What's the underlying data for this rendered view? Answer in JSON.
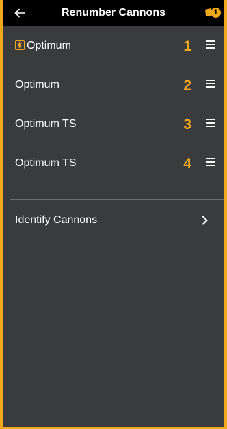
{
  "header": {
    "title": "Renumber Cannons",
    "notification_count": "1"
  },
  "cannons": [
    {
      "name": "Optimum",
      "number": "1",
      "bluetooth": true
    },
    {
      "name": "Optimum",
      "number": "2",
      "bluetooth": false
    },
    {
      "name": "Optimum TS",
      "number": "3",
      "bluetooth": false
    },
    {
      "name": "Optimum TS",
      "number": "4",
      "bluetooth": false
    }
  ],
  "identify": {
    "label": "Identify Cannons"
  },
  "colors": {
    "accent": "#f2a81d",
    "background": "#3a3b3d",
    "header": "#000000"
  },
  "icons": {
    "back": "arrow-left-icon",
    "notification": "cannon-notification-icon",
    "bluetooth": "bluetooth-icon",
    "drag": "drag-handle-icon",
    "chevron": "chevron-right-icon"
  }
}
